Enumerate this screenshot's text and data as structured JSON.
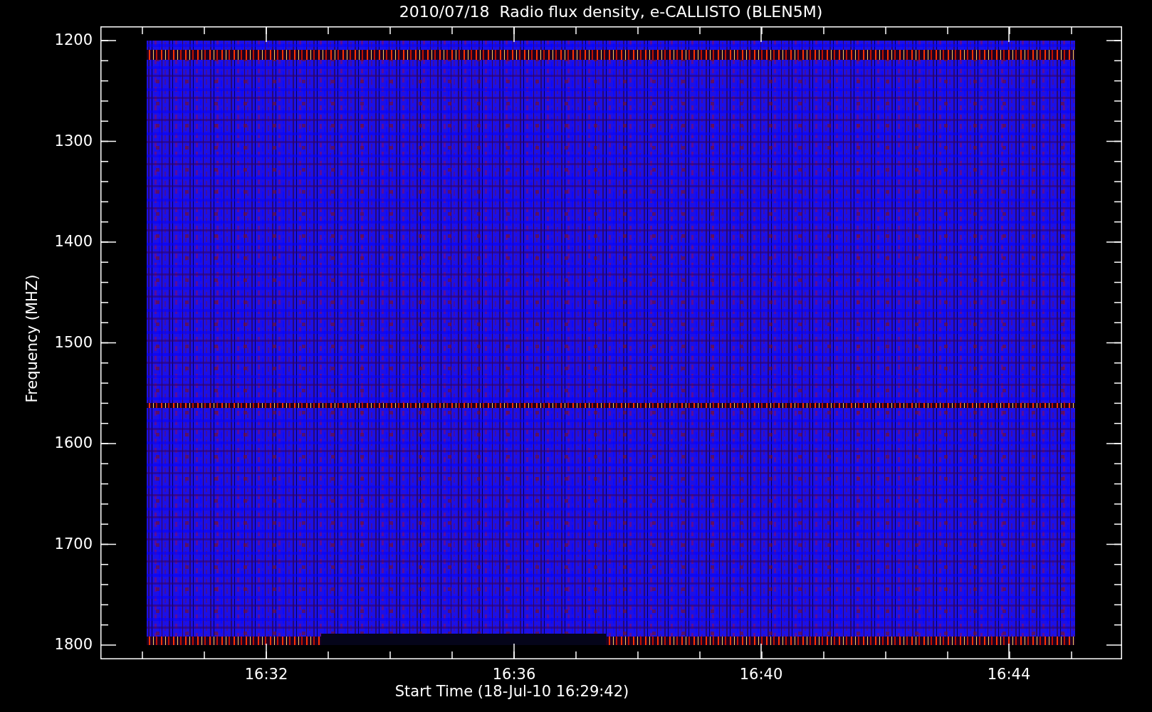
{
  "title": "2010/07/18  Radio flux density, e-CALLISTO (BLEN5M)",
  "y_axis": {
    "label": "Frequency (MHZ)",
    "ticks": [
      "1200",
      "1300",
      "1400",
      "1500",
      "1600",
      "1700",
      "1800"
    ]
  },
  "x_axis": {
    "label": "Start Time (18-Jul-10 16:29:42)",
    "ticks": [
      "16:32",
      "16:36",
      "16:40",
      "16:44"
    ]
  }
}
